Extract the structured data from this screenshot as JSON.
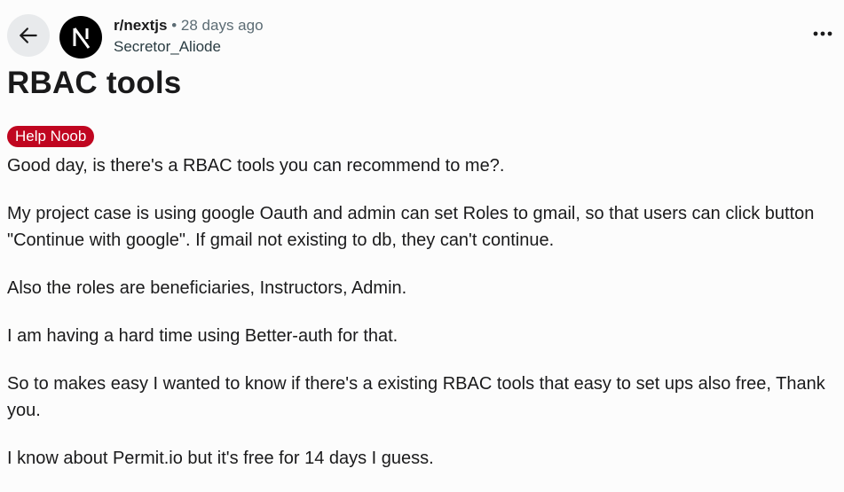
{
  "post": {
    "subreddit": "r/nextjs",
    "separator": "•",
    "time": "28 days ago",
    "author": "Secretor_Aliode",
    "title": "RBAC tools",
    "flair": "Help Noob",
    "paragraphs": [
      "Good day, is there's a RBAC tools you can recommend to me?.",
      "My project case is using google Oauth and admin can set Roles to gmail, so that users can click button \"Continue with google\". If gmail not existing to db, they can't continue.",
      "Also the roles are beneficiaries, Instructors, Admin.",
      "I am having a hard time using Better-auth for that.",
      "So to makes easy I wanted to know if there's a existing RBAC tools that easy to set ups also free, Thank you.",
      "I know about Permit.io but it's free for 14 days I guess."
    ]
  },
  "icons": {
    "back": "arrow-left-icon",
    "avatar": "nextjs-logo-icon",
    "more": "more-horizontal-icon"
  },
  "colors": {
    "background": "#fcfcfc",
    "flair_background": "#c00620",
    "flair_text": "#ffffff",
    "back_button_background": "#e8eaec",
    "text": "#1a1a1b",
    "muted_text": "#5c6c74"
  }
}
